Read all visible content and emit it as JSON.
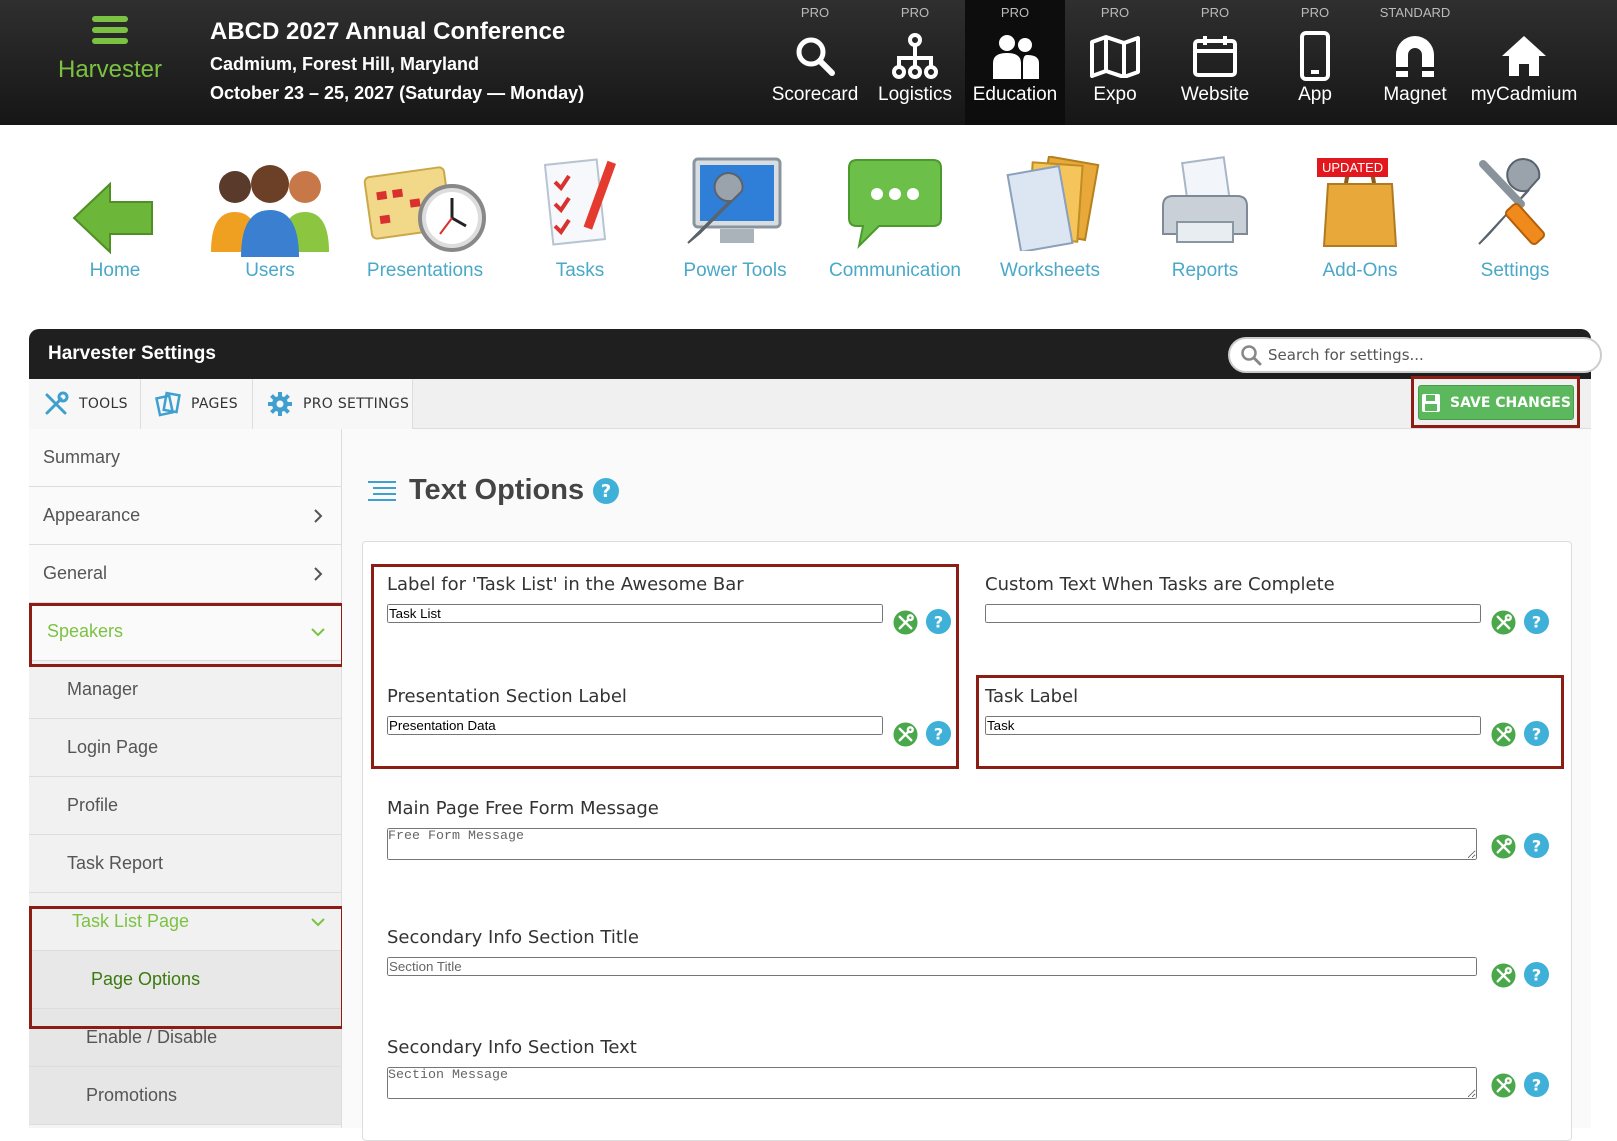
{
  "header": {
    "app_name": "Harvester",
    "event_title": "ABCD 2027 Annual Conference",
    "event_location": "Cadmium, Forest Hill, Maryland",
    "event_dates": "October 23 – 25, 2027 (Saturday — Monday)",
    "modules": [
      {
        "tier": "PRO",
        "label": "Scorecard",
        "icon": "search-icon"
      },
      {
        "tier": "PRO",
        "label": "Logistics",
        "icon": "hierarchy-icon"
      },
      {
        "tier": "PRO",
        "label": "Education",
        "icon": "people-icon",
        "active": true
      },
      {
        "tier": "PRO",
        "label": "Expo",
        "icon": "map-icon"
      },
      {
        "tier": "PRO",
        "label": "Website",
        "icon": "calendar-icon"
      },
      {
        "tier": "PRO",
        "label": "App",
        "icon": "phone-icon"
      },
      {
        "tier": "STANDARD",
        "label": "Magnet",
        "icon": "magnet-icon"
      },
      {
        "tier": "",
        "label": "myCadmium",
        "icon": "home-icon"
      }
    ]
  },
  "main_menu": {
    "items": [
      {
        "label": "Home",
        "icon": "back-arrow-icon"
      },
      {
        "label": "Users",
        "icon": "users-icon"
      },
      {
        "label": "Presentations",
        "icon": "calendar-clock-icon"
      },
      {
        "label": "Tasks",
        "icon": "checklist-icon"
      },
      {
        "label": "Power Tools",
        "icon": "monitor-wrench-icon"
      },
      {
        "label": "Communication",
        "icon": "chat-bubble-icon"
      },
      {
        "label": "Worksheets",
        "icon": "documents-icon"
      },
      {
        "label": "Reports",
        "icon": "printer-icon"
      },
      {
        "label": "Add-Ons",
        "icon": "shopping-bag-icon",
        "badge": "UPDATED"
      },
      {
        "label": "Settings",
        "icon": "tools-icon"
      }
    ]
  },
  "panel": {
    "title": "Harvester Settings",
    "search_placeholder": "Search for settings...",
    "tabs": [
      {
        "label": "TOOLS",
        "icon": "tools-icon"
      },
      {
        "label": "PAGES",
        "icon": "pages-icon"
      },
      {
        "label": "PRO SETTINGS",
        "icon": "gear-icon"
      }
    ],
    "save_label": "SAVE CHANGES"
  },
  "sidebar": {
    "items": [
      {
        "label": "Summary"
      },
      {
        "label": "Appearance"
      },
      {
        "label": "General"
      },
      {
        "label": "Speakers"
      },
      {
        "label": "Manager"
      },
      {
        "label": "Login Page"
      },
      {
        "label": "Profile"
      },
      {
        "label": "Task Report"
      },
      {
        "label": "Task List Page"
      },
      {
        "label": "Page Options"
      },
      {
        "label": "Enable / Disable"
      },
      {
        "label": "Promotions"
      }
    ]
  },
  "content": {
    "section_title": "Text Options",
    "fields": [
      {
        "label": "Label for 'Task List' in the Awesome Bar",
        "value": "Task List",
        "placeholder": ""
      },
      {
        "label": "Custom Text When Tasks are Complete",
        "value": "",
        "placeholder": ""
      },
      {
        "label": "Presentation Section Label",
        "value": "Presentation Data",
        "placeholder": ""
      },
      {
        "label": "Task Label",
        "value": "Task",
        "placeholder": ""
      },
      {
        "label": "Main Page Free Form Message",
        "value": "",
        "placeholder": "Free Form Message"
      },
      {
        "label": "Secondary Info Section Title",
        "value": "",
        "placeholder": "Section Title"
      },
      {
        "label": "Secondary Info Section Text",
        "value": "",
        "placeholder": "Section Message"
      }
    ]
  },
  "colors": {
    "topbar": "#1a1a1a",
    "brand_green": "#7cc242",
    "menu_label": "#4aa8c8",
    "save_green": "#5cb85c",
    "highlight": "#8b1d14",
    "help_blue": "#3fb0d8"
  }
}
